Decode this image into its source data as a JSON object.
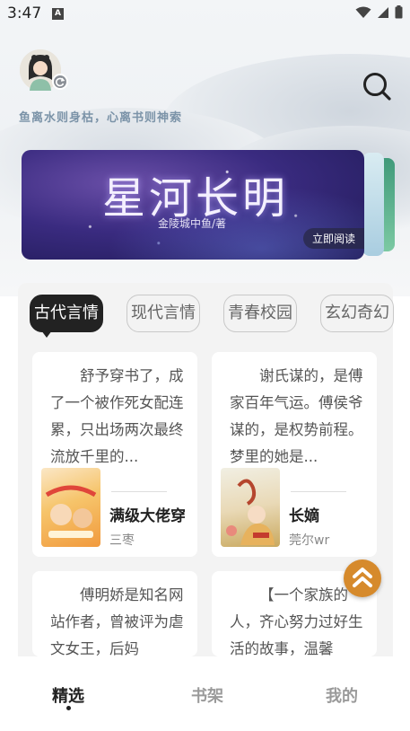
{
  "status_bar": {
    "time": "3:47",
    "notification_badge": "A"
  },
  "header": {
    "slogan": "鱼离水则身枯，心离书则神索"
  },
  "banner": {
    "title": "星河长明",
    "author": "金陵城中鱼/著",
    "read_button": "立即阅读"
  },
  "tabs": [
    {
      "label": "古代言情",
      "active": true
    },
    {
      "label": "现代言情",
      "active": false
    },
    {
      "label": "青春校园",
      "active": false
    },
    {
      "label": "玄幻奇幻",
      "active": false
    }
  ],
  "books": [
    {
      "description": "舒予穿书了，成了一个被作死女配连累，只出场两次最终流放千里的...",
      "title": "满级大佬穿",
      "author": "三枣"
    },
    {
      "description": "谢氏谋的，是傅家百年气运。傅侯爷谋的，是权势前程。梦里的她是...",
      "title": "长嫡",
      "author": "莞尔wr"
    },
    {
      "description": "傅明娇是知名网站作者，曾被评为虐文女王，后妈",
      "title": "",
      "author": ""
    },
    {
      "description": "【一个家族的人，齐心努力过好生活的故事，温馨",
      "title": "",
      "author": ""
    }
  ],
  "bottom_nav": [
    {
      "label": "精选",
      "active": true
    },
    {
      "label": "书架",
      "active": false
    },
    {
      "label": "我的",
      "active": false
    }
  ],
  "colors": {
    "accent": "#d68a2c",
    "active_tab_bg": "#222222",
    "slogan": "#7b93a8"
  }
}
